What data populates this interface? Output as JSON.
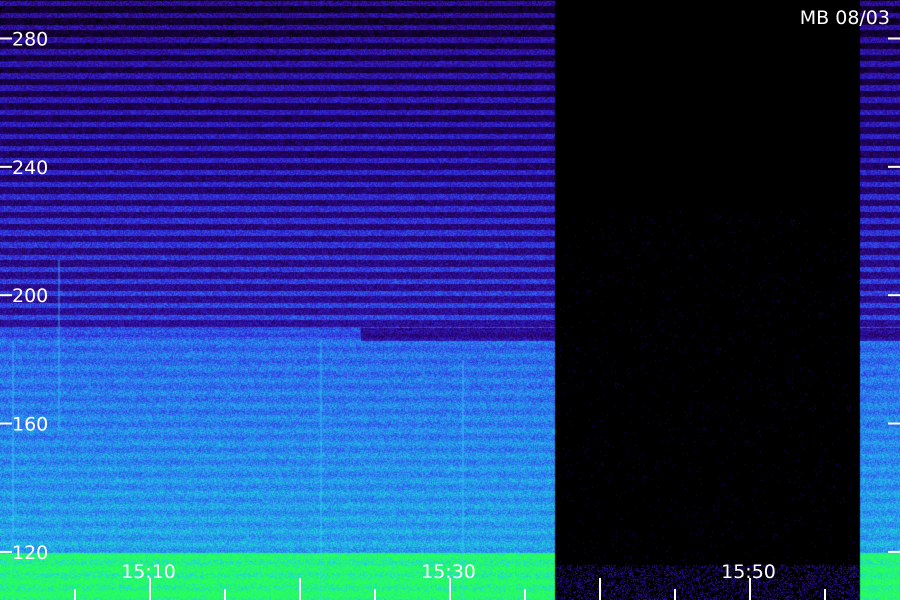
{
  "chart_data": {
    "type": "heatmap",
    "title": "MB 08/03",
    "y_ticks": [
      "120",
      "160",
      "200",
      "240",
      "280"
    ],
    "y_tick_values": [
      120,
      160,
      200,
      240,
      280
    ],
    "ylim": [
      105,
      292
    ],
    "x_ticks": [
      "15:10",
      "15:30",
      "15:50"
    ],
    "x_tick_minutes": [
      10,
      30,
      50
    ],
    "xlim_minutes": [
      0,
      60
    ],
    "minor_tick_interval_minutes": 5,
    "data_gaps_minutes": [
      [
        37,
        57.3
      ]
    ],
    "colors": {
      "background": "#000000",
      "low": "#1a0060",
      "mid": "#2a2ad8",
      "high": "#1ad0e0",
      "peak": "#22ff60",
      "tick": "#ffffff"
    }
  }
}
